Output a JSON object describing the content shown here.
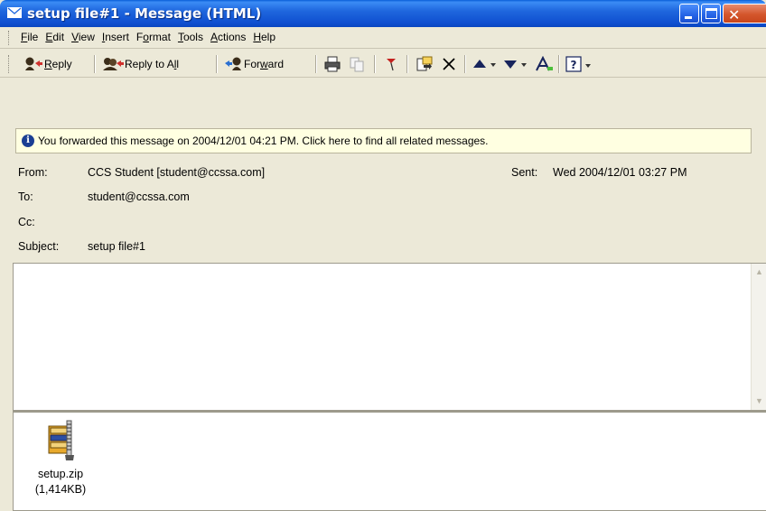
{
  "window": {
    "title": "setup file#1 - Message (HTML)",
    "minimize": "minimize",
    "maximize": "maximize",
    "close": "close"
  },
  "menu": [
    {
      "label": "File",
      "key": "F",
      "rest": "ile"
    },
    {
      "label": "Edit",
      "key": "E",
      "rest": "dit"
    },
    {
      "label": "View",
      "key": "V",
      "rest": "iew"
    },
    {
      "label": "Insert",
      "key": "I",
      "rest": "nsert"
    },
    {
      "label": "Format",
      "pre": "F",
      "key": "o",
      "rest": "rmat"
    },
    {
      "label": "Tools",
      "key": "T",
      "rest": "ools"
    },
    {
      "label": "Actions",
      "key": "A",
      "rest": "ctions"
    },
    {
      "label": "Help",
      "key": "H",
      "rest": "elp"
    }
  ],
  "toolbar": {
    "reply": {
      "key": "R",
      "rest": "eply"
    },
    "reply_all": {
      "pre": "Reply to A",
      "key": "l",
      "rest": "l"
    },
    "forward": {
      "pre": "For",
      "key": "w",
      "rest": "ard"
    },
    "icons": [
      "reply-icon",
      "reply-all-icon",
      "forward-icon",
      "print-icon",
      "copy-icon",
      "flag-icon",
      "move-icon",
      "delete-icon",
      "previous-item-icon",
      "next-item-icon",
      "address-book-icon",
      "help-icon"
    ]
  },
  "infobar": {
    "text": "You forwarded this message on 2004/12/01 04:21 PM. Click here to find all related messages."
  },
  "header": {
    "from_label": "From:",
    "from_value": "CCS Student [student@ccssa.com]",
    "sent_label": "Sent:",
    "sent_value": "Wed 2004/12/01 03:27 PM",
    "to_label": "To:",
    "to_value": "student@ccssa.com",
    "cc_label": "Cc:",
    "cc_value": "",
    "subject_label": "Subject:",
    "subject_value": "setup file#1"
  },
  "body": {
    "text": ""
  },
  "attachment": {
    "name": "setup.zip",
    "size": "(1,414KB)",
    "icon": "zip-archive-icon"
  },
  "colors": {
    "title_bar": "#1f67de",
    "infobar_bg": "#ffffe1",
    "chrome_bg": "#ece9d8"
  }
}
